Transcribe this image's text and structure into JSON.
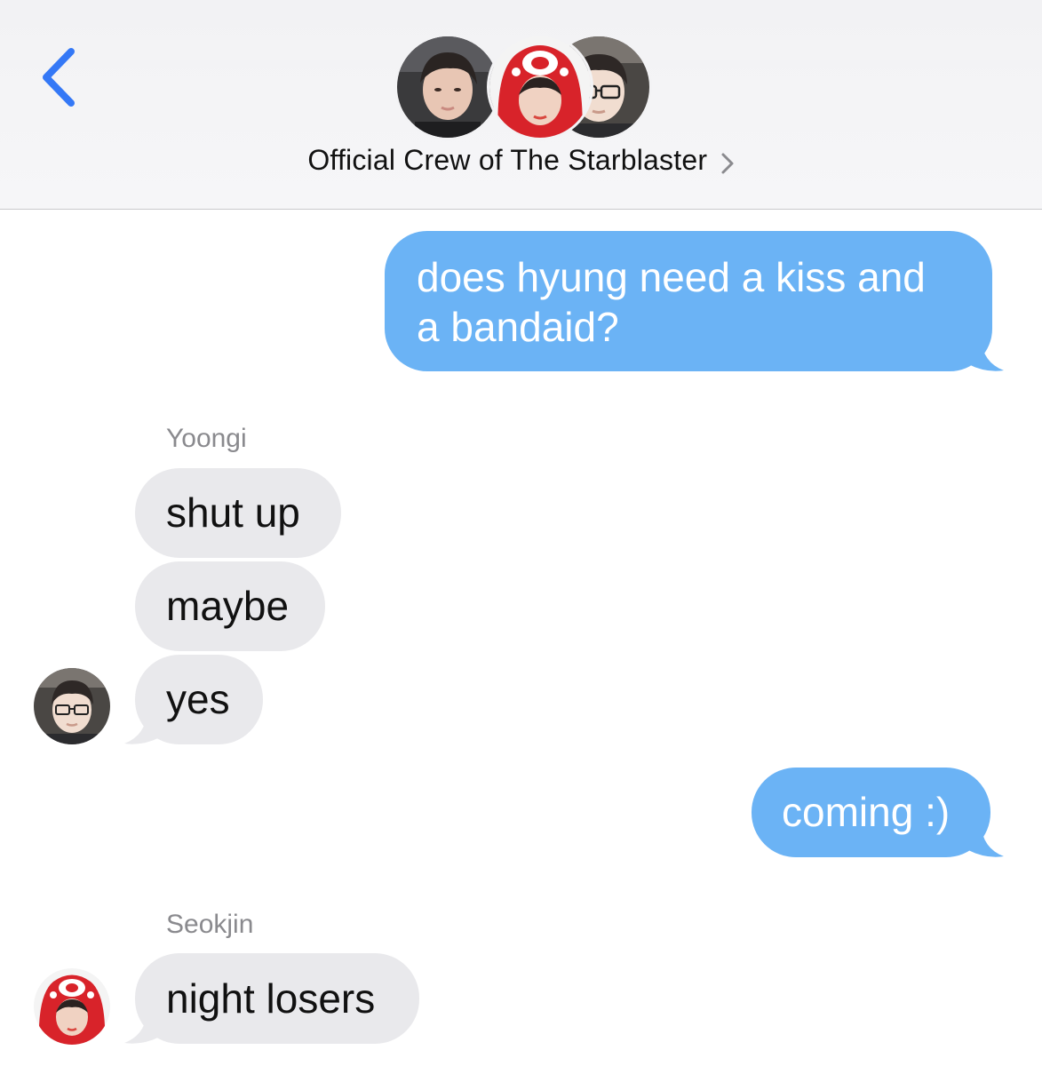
{
  "header": {
    "back_icon": "chevron-left-icon",
    "group_title": "Official Crew of The Starblaster",
    "title_chevron_icon": "chevron-right-icon",
    "accent_color": "#3478f6",
    "avatars": [
      {
        "description_icon": "member-avatar-1"
      },
      {
        "description_icon": "member-avatar-2-red-hood"
      },
      {
        "description_icon": "member-avatar-3-glasses"
      }
    ]
  },
  "colors": {
    "sent_bubble": "#6bb3f5",
    "received_bubble": "#e9e9ec",
    "sender_label": "#8a8a8e"
  },
  "messages": [
    {
      "direction": "sent",
      "text": "does hyung need a kiss and\na bandaid?"
    },
    {
      "direction": "received",
      "sender": "Yoongi",
      "text": "shut up"
    },
    {
      "direction": "received",
      "sender": "Yoongi",
      "text": "maybe"
    },
    {
      "direction": "received",
      "sender": "Yoongi",
      "text": "yes"
    },
    {
      "direction": "sent",
      "text": "coming :)"
    },
    {
      "direction": "received",
      "sender": "Seokjin",
      "text": "night losers"
    }
  ],
  "sender_labels": {
    "yoongi": "Yoongi",
    "seokjin": "Seokjin"
  }
}
